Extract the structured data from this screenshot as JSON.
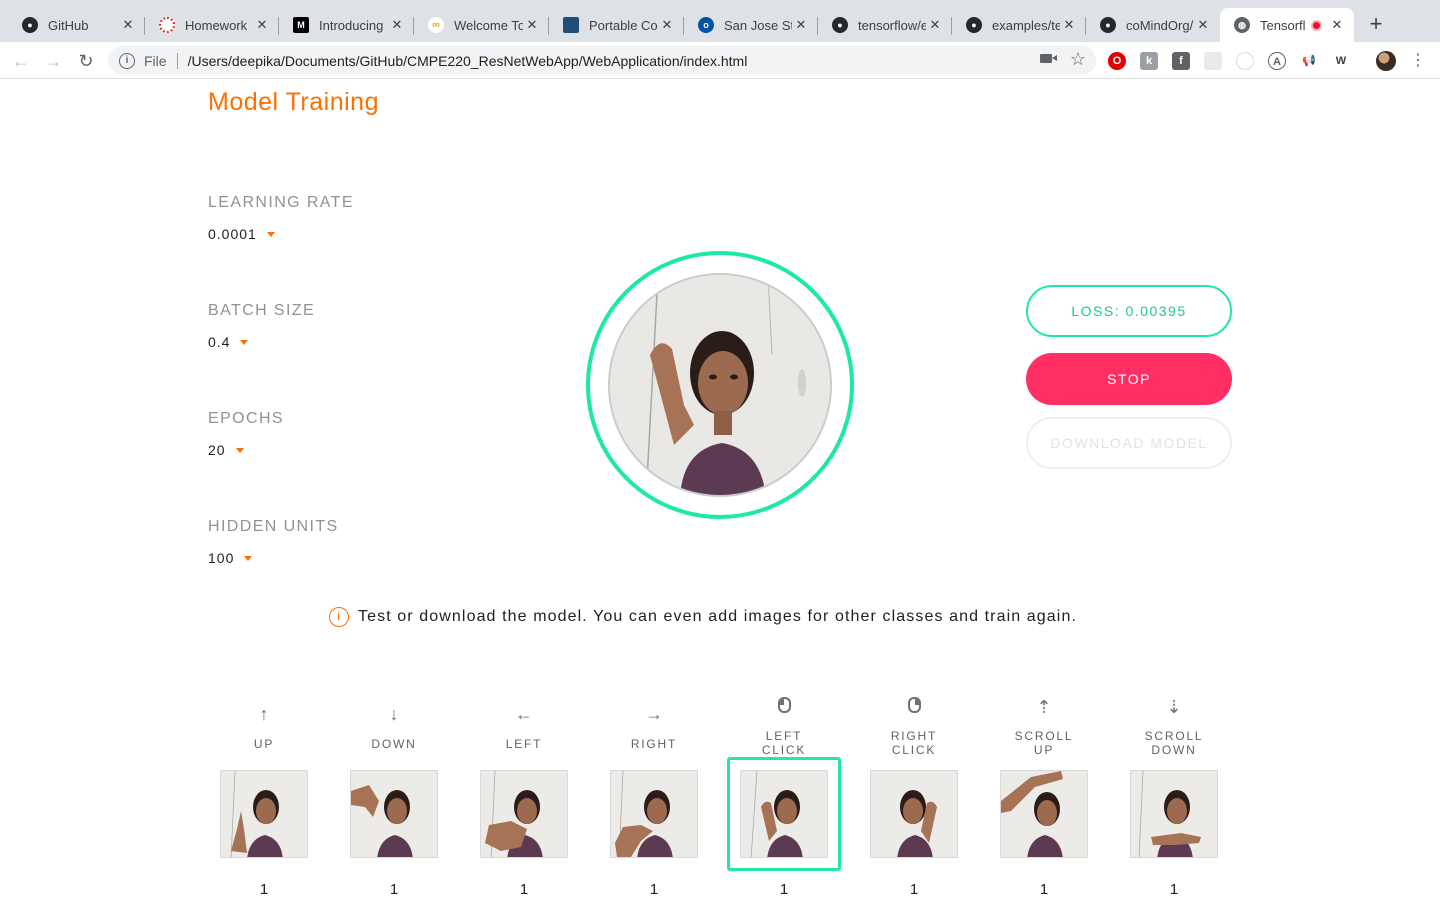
{
  "browser": {
    "tabs": [
      {
        "title": "GitHub",
        "icon": "github-icon",
        "color": "#24292e"
      },
      {
        "title": "Homework",
        "icon": "homework-icon",
        "color": "#d93025"
      },
      {
        "title": "Introducing",
        "icon": "medium-icon",
        "color": "#000000"
      },
      {
        "title": "Welcome To",
        "icon": "colab-icon",
        "color": "#f9ab00"
      },
      {
        "title": "Portable Cor",
        "icon": "document-icon",
        "color": "#1f4e79"
      },
      {
        "title": "San Jose Sta",
        "icon": "university-icon",
        "color": "#0055a2"
      },
      {
        "title": "tensorflow/e",
        "icon": "github-icon",
        "color": "#24292e"
      },
      {
        "title": "examples/te",
        "icon": "github-icon",
        "color": "#24292e"
      },
      {
        "title": "coMindOrg/",
        "icon": "github-icon",
        "color": "#24292e"
      },
      {
        "title": "Tensorfl",
        "icon": "globe-icon",
        "color": "#5f6368",
        "active": true,
        "recording": true
      }
    ],
    "new_tab_symbol": "+",
    "address": {
      "scheme": "File",
      "url": "/Users/deepika/Documents/GitHub/CMPE220_ResNetWebApp/WebApplication/index.html"
    }
  },
  "page": {
    "title": "Model Training",
    "params": [
      {
        "label": "LEARNING RATE",
        "value": "0.0001"
      },
      {
        "label": "BATCH SIZE",
        "value": "0.4"
      },
      {
        "label": "EPOCHS",
        "value": "20"
      },
      {
        "label": "HIDDEN UNITS",
        "value": "100"
      }
    ],
    "buttons": {
      "loss": "LOSS: 0.00395",
      "stop": "STOP",
      "download": "DOWNLOAD MODEL"
    },
    "message": "Test or download the model. You can even add images for other classes and train again.",
    "classes": [
      {
        "label": "UP",
        "icon": "arrow-up-icon",
        "count": "1"
      },
      {
        "label": "DOWN",
        "icon": "arrow-down-icon",
        "count": "1"
      },
      {
        "label": "LEFT",
        "icon": "arrow-left-icon",
        "count": "1"
      },
      {
        "label": "RIGHT",
        "icon": "arrow-right-icon",
        "count": "1"
      },
      {
        "label": "LEFT\nCLICK",
        "icon": "mouse-left-click-icon",
        "count": "1",
        "selected": true
      },
      {
        "label": "RIGHT\nCLICK",
        "icon": "mouse-right-click-icon",
        "count": "1"
      },
      {
        "label": "SCROLL\nUP",
        "icon": "scroll-up-icon",
        "count": "1"
      },
      {
        "label": "SCROLL\nDOWN",
        "icon": "scroll-down-icon",
        "count": "1"
      }
    ],
    "colors": {
      "accent": "#ff6f00",
      "loss": "#1de9a0",
      "stop": "#ff2e63"
    }
  }
}
